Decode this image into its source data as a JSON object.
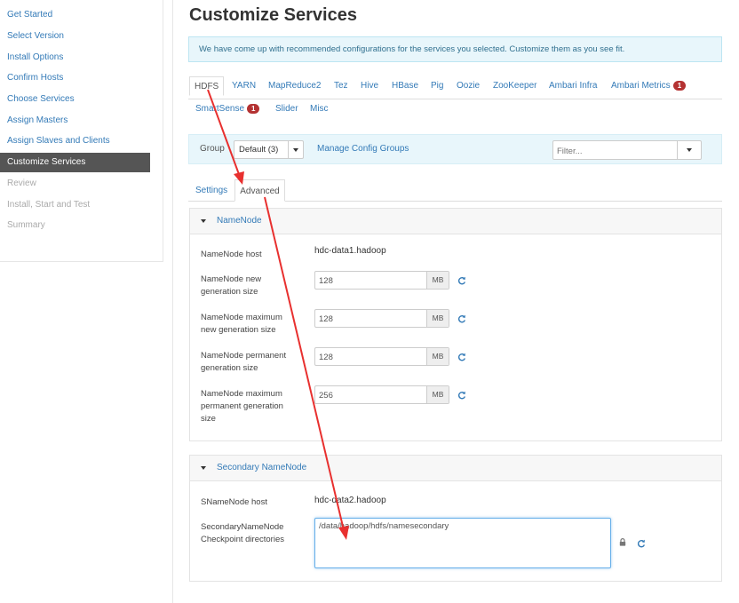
{
  "sidebar": {
    "items": [
      {
        "label": "Get Started",
        "state": "link"
      },
      {
        "label": "Select Version",
        "state": "link"
      },
      {
        "label": "Install Options",
        "state": "link"
      },
      {
        "label": "Confirm Hosts",
        "state": "link"
      },
      {
        "label": "Choose Services",
        "state": "link"
      },
      {
        "label": "Assign Masters",
        "state": "link"
      },
      {
        "label": "Assign Slaves and Clients",
        "state": "link"
      },
      {
        "label": "Customize Services",
        "state": "active"
      },
      {
        "label": "Review",
        "state": "disabled"
      },
      {
        "label": "Install, Start and Test",
        "state": "disabled"
      },
      {
        "label": "Summary",
        "state": "disabled"
      }
    ]
  },
  "header": {
    "title": "Customize Services",
    "info": "We have come up with recommended configurations for the services you selected. Customize them as you see fit."
  },
  "service_tabs": [
    {
      "label": "HDFS",
      "active": true
    },
    {
      "label": "YARN"
    },
    {
      "label": "MapReduce2"
    },
    {
      "label": "Tez"
    },
    {
      "label": "Hive"
    },
    {
      "label": "HBase"
    },
    {
      "label": "Pig"
    },
    {
      "label": "Oozie"
    },
    {
      "label": "ZooKeeper"
    },
    {
      "label": "Ambari Infra"
    },
    {
      "label": "Ambari Metrics",
      "badge": "1"
    },
    {
      "label": "SmartSense",
      "badge": "1"
    },
    {
      "label": "Slider"
    },
    {
      "label": "Misc"
    }
  ],
  "group_bar": {
    "label": "Group",
    "selected": "Default (3)",
    "manage_link": "Manage Config Groups",
    "filter_placeholder": "Filter..."
  },
  "config_tabs": {
    "settings": "Settings",
    "advanced": "Advanced",
    "active": "advanced"
  },
  "namenode_section": {
    "title": "NameNode",
    "host_label": "NameNode host",
    "host_value": "hdc-data1.hadoop",
    "fields": [
      {
        "label_lines": [
          "NameNode new",
          "generation size"
        ],
        "value": "128",
        "unit": "MB"
      },
      {
        "label_lines": [
          "NameNode maximum",
          "new generation size"
        ],
        "value": "128",
        "unit": "MB"
      },
      {
        "label_lines": [
          "NameNode permanent",
          "generation size"
        ],
        "value": "128",
        "unit": "MB"
      },
      {
        "label_lines": [
          "NameNode maximum",
          "permanent generation",
          "size"
        ],
        "value": "256",
        "unit": "MB"
      }
    ]
  },
  "secondary_section": {
    "title": "Secondary NameNode",
    "host_label": "SNameNode host",
    "host_value": "hdc-data2.hadoop",
    "checkpoint_label_lines": [
      "SecondaryNameNode",
      "Checkpoint directories"
    ],
    "checkpoint_value": "/data/hadoop/hdfs/namesecondary"
  },
  "colors": {
    "link": "#337ab7",
    "active_sidebar_bg": "#555555",
    "info_bg": "#e8f6fb",
    "badge": "#b43232",
    "annotation_arrow": "#e8302f"
  },
  "icons": {
    "refresh": "refresh-icon",
    "lock": "lock-icon",
    "caret": "caret-down-icon",
    "collapse": "collapse-triangle-icon"
  }
}
